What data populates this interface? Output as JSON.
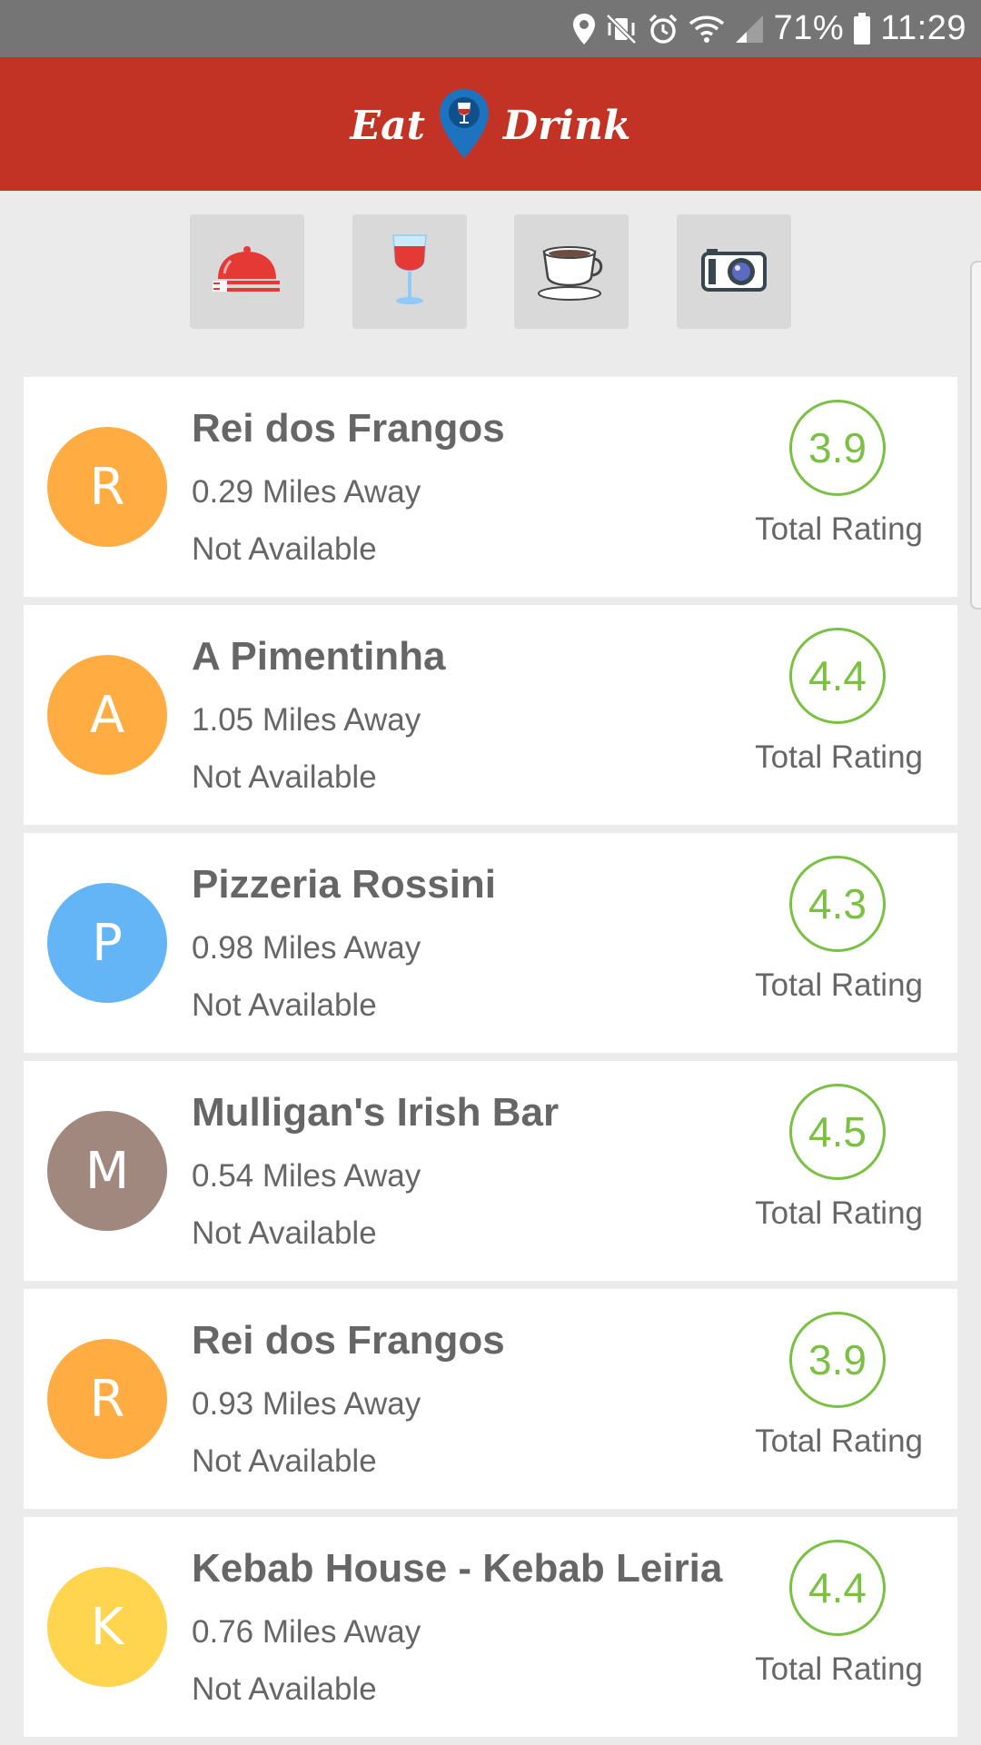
{
  "status_bar": {
    "battery": "71%",
    "time": "11:29",
    "icons": [
      "location-icon",
      "vibrate-mute-icon",
      "alarm-icon",
      "wifi-icon",
      "signal-icon",
      "battery-icon"
    ]
  },
  "app_bar": {
    "logo_left": "Eat",
    "logo_right": "Drink",
    "background": "#c23325"
  },
  "categories": [
    {
      "name": "restaurant",
      "icon": "food-cloche-icon"
    },
    {
      "name": "bar",
      "icon": "wine-glass-icon"
    },
    {
      "name": "cafe",
      "icon": "coffee-cup-icon"
    },
    {
      "name": "sights",
      "icon": "camera-icon"
    }
  ],
  "places": [
    {
      "initial": "R",
      "avatar_color": "#ffad42",
      "name": "Rei dos Frangos",
      "distance": "0.29 Miles Away",
      "availability": "Not Available",
      "rating": "3.9",
      "rating_label": "Total Rating"
    },
    {
      "initial": "A",
      "avatar_color": "#ffad42",
      "name": "A Pimentinha",
      "distance": "1.05 Miles Away",
      "availability": "Not Available",
      "rating": "4.4",
      "rating_label": "Total Rating"
    },
    {
      "initial": "P",
      "avatar_color": "#64b5f6",
      "name": "Pizzeria Rossini",
      "distance": "0.98 Miles Away",
      "availability": "Not Available",
      "rating": "4.3",
      "rating_label": "Total Rating"
    },
    {
      "initial": "M",
      "avatar_color": "#a1887f",
      "name": "Mulligan's Irish Bar",
      "distance": "0.54 Miles Away",
      "availability": "Not Available",
      "rating": "4.5",
      "rating_label": "Total Rating"
    },
    {
      "initial": "R",
      "avatar_color": "#ffad42",
      "name": "Rei dos Frangos",
      "distance": "0.93 Miles Away",
      "availability": "Not Available",
      "rating": "3.9",
      "rating_label": "Total Rating"
    },
    {
      "initial": "K",
      "avatar_color": "#ffd54f",
      "name": "Kebab House - Kebab Leiria",
      "distance": "0.76 Miles Away",
      "availability": "Not Available",
      "rating": "4.4",
      "rating_label": "Total Rating"
    }
  ]
}
